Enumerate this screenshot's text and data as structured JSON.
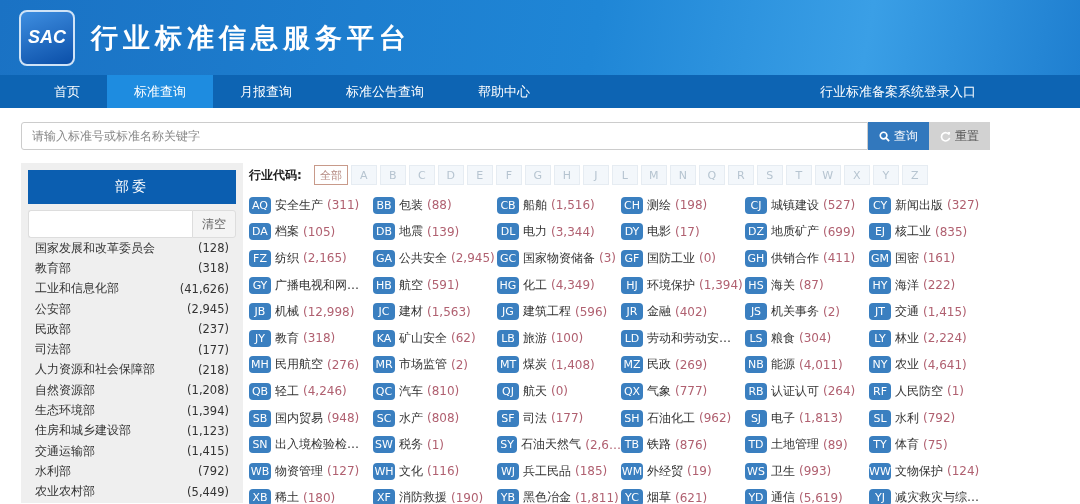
{
  "header": {
    "logo": "SAC",
    "title": "行业标准信息服务平台"
  },
  "nav": {
    "items": [
      {
        "label": "首页",
        "selected": false
      },
      {
        "label": "标准查询",
        "selected": true
      },
      {
        "label": "月报查询",
        "selected": false
      },
      {
        "label": "标准公告查询",
        "selected": false
      },
      {
        "label": "帮助中心",
        "selected": false
      }
    ],
    "login_link": "行业标准备案系统登录入口"
  },
  "search": {
    "placeholder": "请输入标准号或标准名称关键字",
    "search_button": "查询",
    "reset_button": "重置"
  },
  "ministries": {
    "title": "部委",
    "filter_button": "清空",
    "items": [
      {
        "name": "国家发展和改革委员会",
        "count": "(128)"
      },
      {
        "name": "教育部",
        "count": "(318)"
      },
      {
        "name": "工业和信息化部",
        "count": "(41,626)"
      },
      {
        "name": "公安部",
        "count": "(2,945)"
      },
      {
        "name": "民政部",
        "count": "(237)"
      },
      {
        "name": "司法部",
        "count": "(177)"
      },
      {
        "name": "人力资源和社会保障部",
        "count": "(218)"
      },
      {
        "name": "自然资源部",
        "count": "(1,208)"
      },
      {
        "name": "生态环境部",
        "count": "(1,394)"
      },
      {
        "name": "住房和城乡建设部",
        "count": "(1,123)"
      },
      {
        "name": "交通运输部",
        "count": "(1,415)"
      },
      {
        "name": "水利部",
        "count": "(792)"
      },
      {
        "name": "农业农村部",
        "count": "(5,449)"
      }
    ]
  },
  "industry_codes": {
    "label": "行业代码:",
    "letters": [
      {
        "label": "全部",
        "selected": true
      },
      {
        "label": "A",
        "selected": false
      },
      {
        "label": "B",
        "selected": false
      },
      {
        "label": "C",
        "selected": false
      },
      {
        "label": "D",
        "selected": false
      },
      {
        "label": "E",
        "selected": false
      },
      {
        "label": "F",
        "selected": false
      },
      {
        "label": "G",
        "selected": false
      },
      {
        "label": "H",
        "selected": false
      },
      {
        "label": "J",
        "selected": false
      },
      {
        "label": "L",
        "selected": false
      },
      {
        "label": "M",
        "selected": false
      },
      {
        "label": "N",
        "selected": false
      },
      {
        "label": "Q",
        "selected": false
      },
      {
        "label": "R",
        "selected": false
      },
      {
        "label": "S",
        "selected": false
      },
      {
        "label": "T",
        "selected": false
      },
      {
        "label": "W",
        "selected": false
      },
      {
        "label": "X",
        "selected": false
      },
      {
        "label": "Y",
        "selected": false
      },
      {
        "label": "Z",
        "selected": false
      }
    ],
    "items": [
      {
        "code": "AQ",
        "name": "安全生产",
        "count": "(311)"
      },
      {
        "code": "BB",
        "name": "包装",
        "count": "(88)"
      },
      {
        "code": "CB",
        "name": "船舶",
        "count": "(1,516)"
      },
      {
        "code": "CH",
        "name": "测绘",
        "count": "(198)"
      },
      {
        "code": "CJ",
        "name": "城镇建设",
        "count": "(527)"
      },
      {
        "code": "CY",
        "name": "新闻出版",
        "count": "(327)"
      },
      {
        "code": "DA",
        "name": "档案",
        "count": "(105)"
      },
      {
        "code": "DB",
        "name": "地震",
        "count": "(139)"
      },
      {
        "code": "DL",
        "name": "电力",
        "count": "(3,344)"
      },
      {
        "code": "DY",
        "name": "电影",
        "count": "(17)"
      },
      {
        "code": "DZ",
        "name": "地质矿产",
        "count": "(699)"
      },
      {
        "code": "EJ",
        "name": "核工业",
        "count": "(835)"
      },
      {
        "code": "FZ",
        "name": "纺织",
        "count": "(2,165)"
      },
      {
        "code": "GA",
        "name": "公共安全",
        "count": "(2,945)"
      },
      {
        "code": "GC",
        "name": "国家物资储备",
        "count": "(3)"
      },
      {
        "code": "GF",
        "name": "国防工业",
        "count": "(0)"
      },
      {
        "code": "GH",
        "name": "供销合作",
        "count": "(411)"
      },
      {
        "code": "GM",
        "name": "国密",
        "count": "(161)"
      },
      {
        "code": "GY",
        "name": "广播电视和网…"
      },
      {
        "code": "HB",
        "name": "航空",
        "count": "(591)"
      },
      {
        "code": "HG",
        "name": "化工",
        "count": "(4,349)"
      },
      {
        "code": "HJ",
        "name": "环境保护",
        "count": "(1,394)"
      },
      {
        "code": "HS",
        "name": "海关",
        "count": "(87)"
      },
      {
        "code": "HY",
        "name": "海洋",
        "count": "(222)"
      },
      {
        "code": "JB",
        "name": "机械",
        "count": "(12,998)"
      },
      {
        "code": "JC",
        "name": "建材",
        "count": "(1,563)"
      },
      {
        "code": "JG",
        "name": "建筑工程",
        "count": "(596)"
      },
      {
        "code": "JR",
        "name": "金融",
        "count": "(402)"
      },
      {
        "code": "JS",
        "name": "机关事务",
        "count": "(2)"
      },
      {
        "code": "JT",
        "name": "交通",
        "count": "(1,415)"
      },
      {
        "code": "JY",
        "name": "教育",
        "count": "(318)"
      },
      {
        "code": "KA",
        "name": "矿山安全",
        "count": "(62)"
      },
      {
        "code": "LB",
        "name": "旅游",
        "count": "(100)"
      },
      {
        "code": "LD",
        "name": "劳动和劳动安…"
      },
      {
        "code": "LS",
        "name": "粮食",
        "count": "(304)"
      },
      {
        "code": "LY",
        "name": "林业",
        "count": "(2,224)"
      },
      {
        "code": "MH",
        "name": "民用航空",
        "count": "(276)"
      },
      {
        "code": "MR",
        "name": "市场监管",
        "count": "(2)"
      },
      {
        "code": "MT",
        "name": "煤炭",
        "count": "(1,408)"
      },
      {
        "code": "MZ",
        "name": "民政",
        "count": "(269)"
      },
      {
        "code": "NB",
        "name": "能源",
        "count": "(4,011)"
      },
      {
        "code": "NY",
        "name": "农业",
        "count": "(4,641)"
      },
      {
        "code": "QB",
        "name": "轻工",
        "count": "(4,246)"
      },
      {
        "code": "QC",
        "name": "汽车",
        "count": "(810)"
      },
      {
        "code": "QJ",
        "name": "航天",
        "count": "(0)"
      },
      {
        "code": "QX",
        "name": "气象",
        "count": "(777)"
      },
      {
        "code": "RB",
        "name": "认证认可",
        "count": "(264)"
      },
      {
        "code": "RF",
        "name": "人民防空",
        "count": "(1)"
      },
      {
        "code": "SB",
        "name": "国内贸易",
        "count": "(948)"
      },
      {
        "code": "SC",
        "name": "水产",
        "count": "(808)"
      },
      {
        "code": "SF",
        "name": "司法",
        "count": "(177)"
      },
      {
        "code": "SH",
        "name": "石油化工",
        "count": "(962)"
      },
      {
        "code": "SJ",
        "name": "电子",
        "count": "(1,813)"
      },
      {
        "code": "SL",
        "name": "水利",
        "count": "(792)"
      },
      {
        "code": "SN",
        "name": "出入境检验检…"
      },
      {
        "code": "SW",
        "name": "税务",
        "count": "(1)"
      },
      {
        "code": "SY",
        "name": "石油天然气",
        "count": "(2,6…"
      },
      {
        "code": "TB",
        "name": "铁路",
        "count": "(876)"
      },
      {
        "code": "TD",
        "name": "土地管理",
        "count": "(89)"
      },
      {
        "code": "TY",
        "name": "体育",
        "count": "(75)"
      },
      {
        "code": "WB",
        "name": "物资管理",
        "count": "(127)"
      },
      {
        "code": "WH",
        "name": "文化",
        "count": "(116)"
      },
      {
        "code": "WJ",
        "name": "兵工民品",
        "count": "(185)"
      },
      {
        "code": "WM",
        "name": "外经贸",
        "count": "(19)"
      },
      {
        "code": "WS",
        "name": "卫生",
        "count": "(993)"
      },
      {
        "code": "WW",
        "name": "文物保护",
        "count": "(124)"
      },
      {
        "code": "XB",
        "name": "稀土",
        "count": "(180)"
      },
      {
        "code": "XF",
        "name": "消防救援",
        "count": "(190)"
      },
      {
        "code": "YB",
        "name": "黑色冶金",
        "count": "(1,811)"
      },
      {
        "code": "YC",
        "name": "烟草",
        "count": "(621)"
      },
      {
        "code": "YD",
        "name": "通信",
        "count": "(5,619)"
      },
      {
        "code": "YJ",
        "name": "减灾救灾与综…"
      }
    ]
  }
}
